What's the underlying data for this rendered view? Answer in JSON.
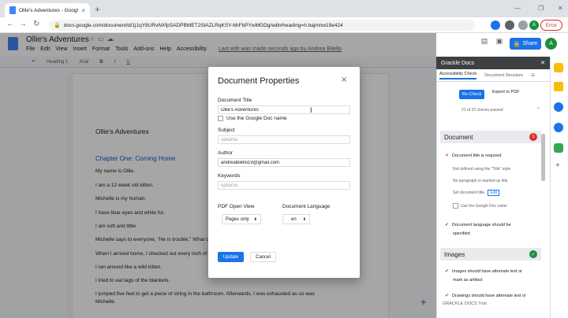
{
  "browser": {
    "tab_title": "Ollie's Adventures - Google Docs",
    "url": "docs.google.com/document/d/1j1qY8URvNXfpSADPBMET2StAZLRqKSY-MrFbPYwMGDg/edit#heading=h.bajmnw19e424",
    "error_label": "Error",
    "avatar_letter": "A"
  },
  "docs": {
    "title": "Ollie's Adventures",
    "menu": [
      "File",
      "Edit",
      "View",
      "Insert",
      "Format",
      "Tools",
      "Add-ons",
      "Help",
      "Accessibility"
    ],
    "last_edit": "Last edit was made seconds ago by Andrea Bilello",
    "share_label": "Share",
    "toolbar": {
      "style": "Heading 1",
      "font": "Arial"
    }
  },
  "document": {
    "lines": [
      {
        "text": "Ollie's Adventures",
        "kind": "h1"
      },
      {
        "text": "Chapter One: Coming Home",
        "kind": "h2"
      },
      {
        "text": "My name is Ollie.",
        "kind": "p"
      },
      {
        "text": "I am a 12 week old kitten.",
        "kind": "p"
      },
      {
        "text": "Michelle is my human.",
        "kind": "p"
      },
      {
        "text": "I have blue eyes and white fur.",
        "kind": "p"
      },
      {
        "text": "I am soft and little.",
        "kind": "p"
      },
      {
        "text": "Michelle says to everyone, \"He is trouble.\" What co",
        "kind": "p"
      },
      {
        "text": "When I arrived home, I checked out every inch of M",
        "kind": "p"
      },
      {
        "text": "I ran around like a wild kitten.",
        "kind": "p"
      },
      {
        "text": "I tried to eat tags of the blankets.",
        "kind": "p"
      },
      {
        "text": "I jumped five feet to get a piece of string in the bathroom. Afterwards, I was exhausted as so was",
        "kind": "p"
      },
      {
        "text": "Michelle.",
        "kind": "p"
      }
    ]
  },
  "sidebar": {
    "header": "Grackle Docs",
    "tabs": [
      "Accessibility Check",
      "Document Structure"
    ],
    "recheck_label": "Re-Check",
    "export_label": "Export to PDF",
    "checks_passed": "21 of 22 checks passed",
    "document_section": {
      "title": "Document",
      "count": "1",
      "error_item": "Document title is required",
      "sub_items": [
        "Not defined using the \"Title\" style",
        "No paragraph is marked as title"
      ],
      "set_title": "Set document title",
      "set_title_btn": "Edit",
      "use_name": "Use the Google Doc name",
      "pass_item_line1": "Document language should be",
      "pass_item_line2": "specified"
    },
    "images_section": {
      "title": "Images",
      "item1_line1": "Images should have alternate text or",
      "item1_line2": "mark as artifact",
      "item2": "Drawings should have alternate text or"
    },
    "footer": "GRACKLE DOCS Trial"
  },
  "modal": {
    "title": "Document Properties",
    "close_glyph": "×",
    "doc_title_label": "Document Title",
    "doc_title_value": "Ollie's Adventures",
    "use_google_name": "Use the Google Doc name",
    "subject_label": "Subject",
    "subject_placeholder": "optional",
    "author_label": "Author",
    "author_value": "andreabilello19@gmail.com",
    "keywords_label": "Keywords",
    "keywords_placeholder": "optional",
    "pdf_view_label": "PDF Open View",
    "pdf_view_value": "Pages only",
    "language_label": "Document Language",
    "language_value": "en",
    "update_label": "Update",
    "cancel_label": "Cancel"
  },
  "colors": {
    "accent": "#1a73e8",
    "error": "#d93025",
    "success": "#1e8e3e"
  }
}
